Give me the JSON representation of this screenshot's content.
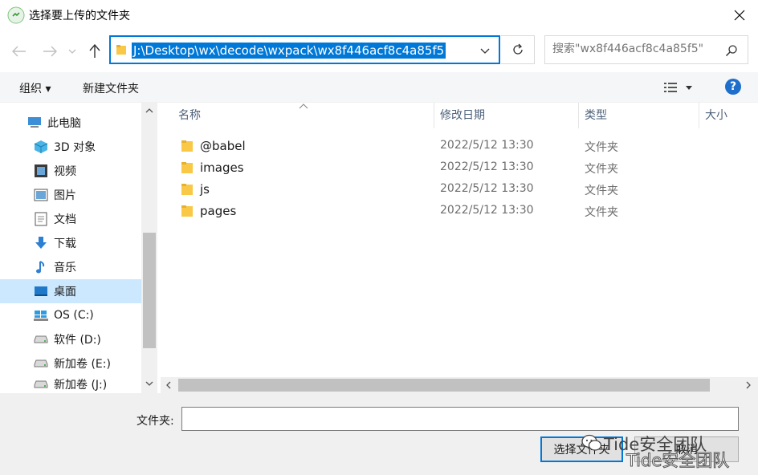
{
  "window": {
    "title": "选择要上传的文件夹"
  },
  "address": {
    "path": "J:\\Desktop\\wx\\decode\\wxpack\\wx8f446acf8c4a85f5",
    "search_placeholder": "搜索\"wx8f446acf8c4a85f5\""
  },
  "toolbar": {
    "organize_label": "组织 ▾",
    "new_folder_label": "新建文件夹"
  },
  "nav": {
    "items": [
      {
        "label": "此电脑",
        "icon": "computer-icon"
      },
      {
        "label": "3D 对象",
        "icon": "3d-objects-icon"
      },
      {
        "label": "视频",
        "icon": "video-icon"
      },
      {
        "label": "图片",
        "icon": "pictures-icon"
      },
      {
        "label": "文档",
        "icon": "documents-icon"
      },
      {
        "label": "下载",
        "icon": "download-icon"
      },
      {
        "label": "音乐",
        "icon": "music-icon"
      },
      {
        "label": "桌面",
        "icon": "desktop-icon",
        "selected": true
      },
      {
        "label": "OS (C:)",
        "icon": "windows-drive-icon"
      },
      {
        "label": "软件 (D:)",
        "icon": "drive-icon"
      },
      {
        "label": "新加卷 (E:)",
        "icon": "drive-icon"
      },
      {
        "label": "新加卷 (J:)",
        "icon": "drive-icon"
      }
    ]
  },
  "columns": {
    "name": "名称",
    "modified": "修改日期",
    "type": "类型",
    "size": "大小"
  },
  "files": [
    {
      "name": "@babel",
      "modified": "2022/5/12 13:30",
      "type": "文件夹"
    },
    {
      "name": "images",
      "modified": "2022/5/12 13:30",
      "type": "文件夹"
    },
    {
      "name": "js",
      "modified": "2022/5/12 13:30",
      "type": "文件夹"
    },
    {
      "name": "pages",
      "modified": "2022/5/12 13:30",
      "type": "文件夹"
    }
  ],
  "footer": {
    "folder_label": "文件夹:",
    "folder_value": "",
    "select_button": "选择文件夹",
    "cancel_button": "取消"
  },
  "watermark": {
    "text": "Tide安全团队"
  },
  "colors": {
    "accent": "#0078d7",
    "selection": "#cce8ff",
    "folder": "#f8c846"
  }
}
